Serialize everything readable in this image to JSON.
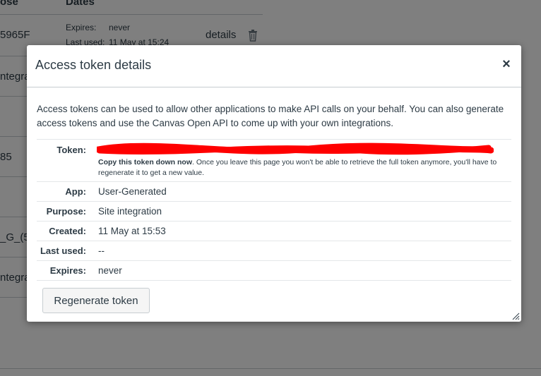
{
  "background": {
    "headers": [
      "ose",
      "Dates"
    ],
    "rows": [
      {
        "name": "5965F",
        "expires_label": "Expires:",
        "expires_value": "never",
        "last_used_label": "Last used:",
        "last_used_value": "11 May at 15:24",
        "link": "details"
      },
      {
        "name": "ntegra"
      },
      {
        "name": "85"
      },
      {
        "name": "_G_(5"
      },
      {
        "name": "ntegra"
      }
    ]
  },
  "modal": {
    "title": "Access token details",
    "close_label": "×",
    "intro": "Access tokens can be used to allow other applications to make API calls on your behalf. You can also generate access tokens and use the Canvas Open API to come up with your own integrations.",
    "token_label": "Token:",
    "token_note_strong": "Copy this token down now",
    "token_note_rest": ". Once you leave this page you won't be able to retrieve the full token anymore, you'll have to regenerate it to get a new value.",
    "fields": [
      {
        "label": "App:",
        "value": "User-Generated"
      },
      {
        "label": "Purpose:",
        "value": "Site integration"
      },
      {
        "label": "Created:",
        "value": "11 May at 15:53"
      },
      {
        "label": "Last used:",
        "value": "--"
      },
      {
        "label": "Expires:",
        "value": "never"
      }
    ],
    "regenerate_label": "Regenerate token"
  },
  "colors": {
    "redaction": "#ff0000",
    "text": "#2d3b45",
    "overlay": "rgba(0,0,0,0.5)"
  }
}
